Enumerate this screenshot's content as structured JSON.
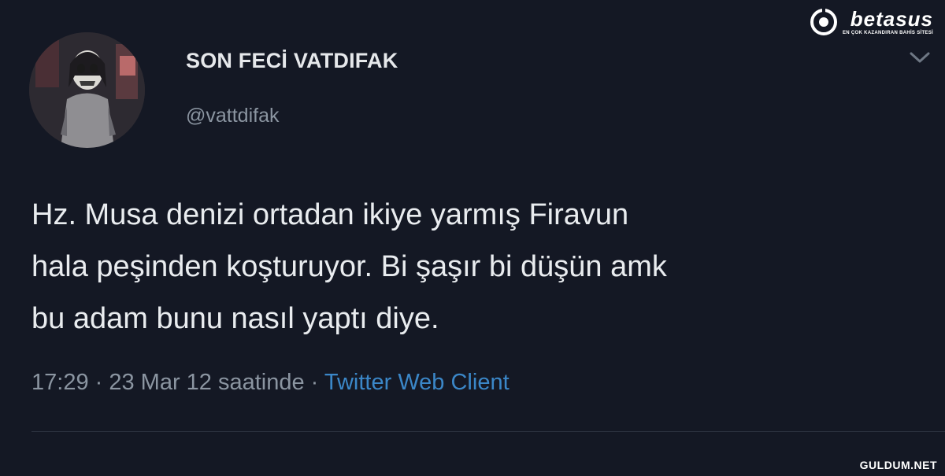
{
  "tweet": {
    "display_name": "SON FECİ VATDIFAK",
    "handle": "@vattdifak",
    "text_lines": [
      "Hz. Musa denizi ortadan ikiye yarmış Firavun",
      "hala peşinden koşturuyor. Bi şaşır bi düşün amk",
      "bu adam bunu nasıl yaptı diye."
    ],
    "timestamp": "17:29 · 23 Mar 12 saatinde ·",
    "client": "Twitter Web Client"
  },
  "brand": {
    "name": "betasus",
    "tagline": "EN ÇOK KAZANDIRAN BAHİS SİTESİ"
  },
  "watermark": "GULDUM.NET",
  "colors": {
    "background": "#141824",
    "text": "#e9ecef",
    "muted": "#8b95a1",
    "link": "#3b87c8"
  },
  "icons": {
    "menu": "chevron-down-icon",
    "brand_logo": "ring-logo-icon"
  }
}
